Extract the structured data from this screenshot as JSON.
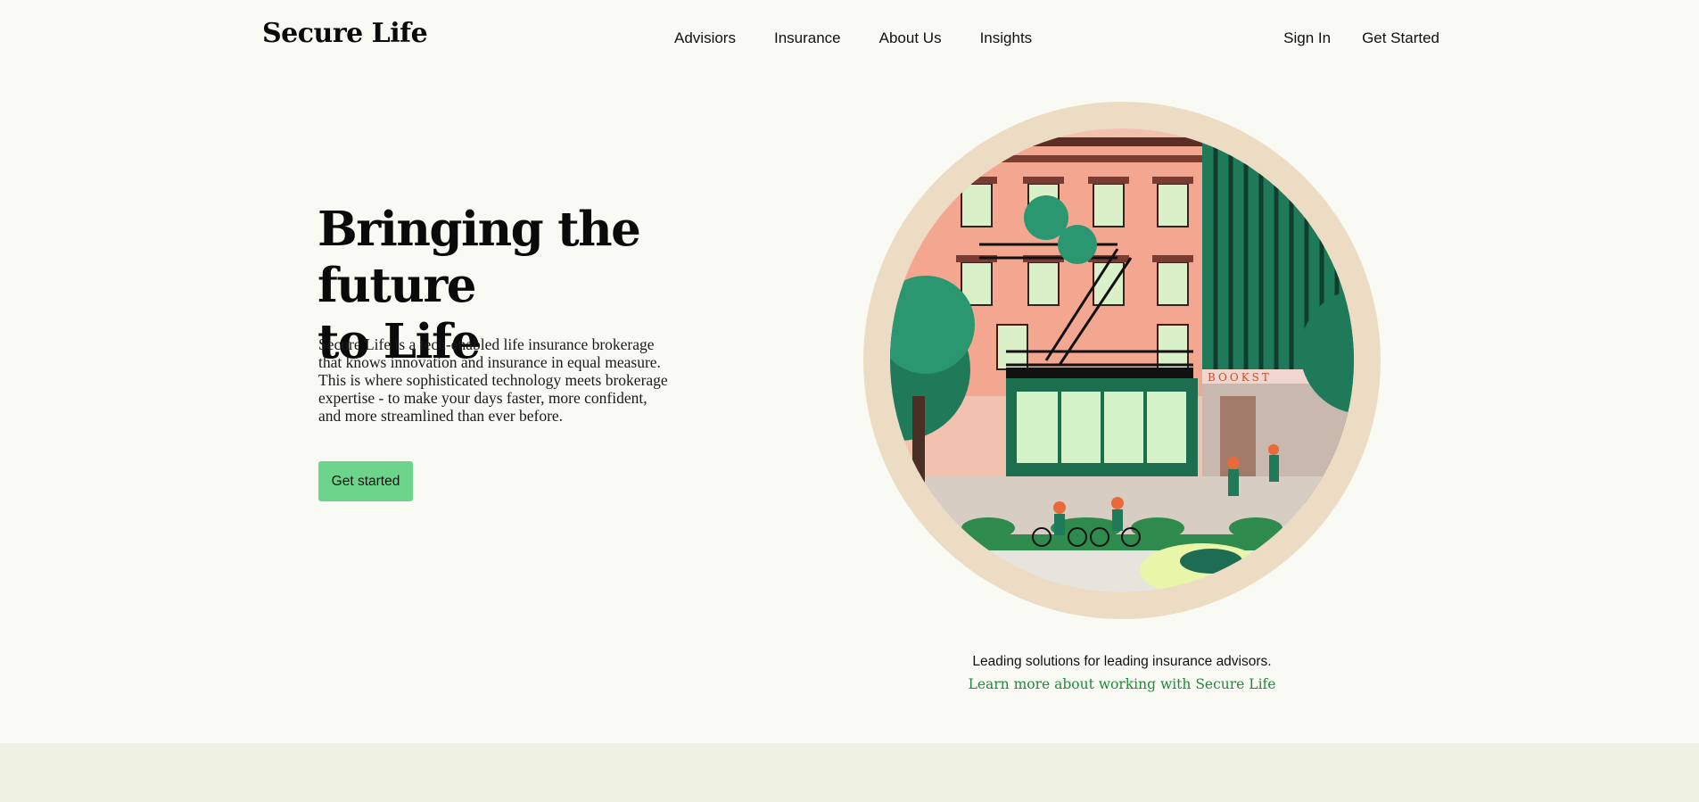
{
  "header": {
    "logo": "Secure Life",
    "nav": [
      "Advisiors",
      "Insurance",
      "About Us",
      "Insights"
    ],
    "sign_in": "Sign In",
    "get_started": "Get Started"
  },
  "hero": {
    "title_line1": "Bringing the future",
    "title_line2": "to Life",
    "description_lines": [
      "Secure Life is a tech-enabled life insurance brokerage",
      "that knows innovation and insurance in equal measure.",
      "This is where sophisticated technology meets brokerage",
      "expertise - to make your days faster, more confident,",
      "and more streamlined than ever before."
    ],
    "cta_label": "Get started"
  },
  "illustration": {
    "storefront_sign": "BOOKST"
  },
  "footer_promo": {
    "tagline": "Leading solutions for leading insurance advisors.",
    "link": "Learn more about working with Secure Life"
  },
  "colors": {
    "background": "#fafaf4",
    "accent_green": "#6dd58b",
    "link_green": "#1f8a3c",
    "ring": "#ecdcc4",
    "band": "#eff1e3"
  }
}
